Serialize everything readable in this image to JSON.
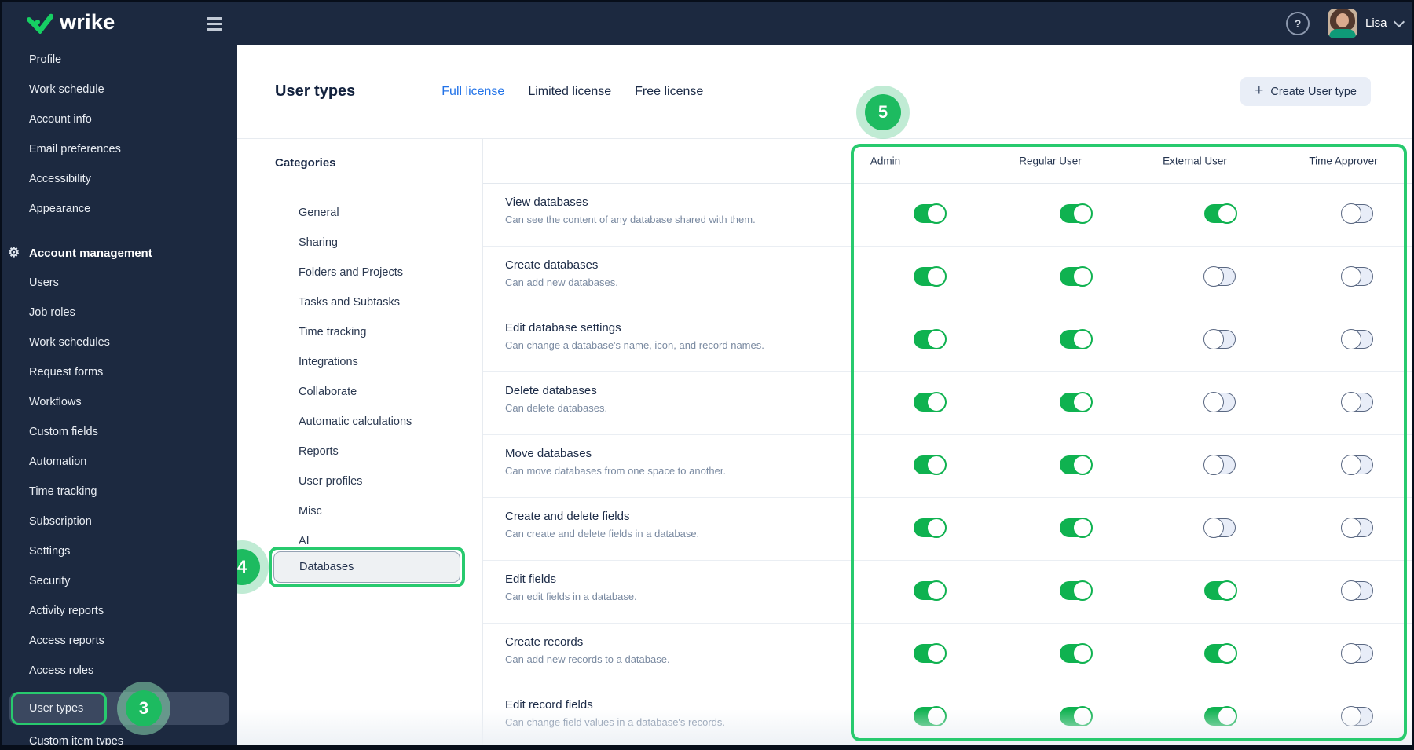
{
  "topbar": {
    "brand": "wrike",
    "help_label": "?",
    "user": {
      "name": "Lisa"
    }
  },
  "sidebar": {
    "items": [
      {
        "label": "Profile",
        "type": "item"
      },
      {
        "label": "Work schedule",
        "type": "item"
      },
      {
        "label": "Account info",
        "type": "item"
      },
      {
        "label": "Email preferences",
        "type": "item"
      },
      {
        "label": "Accessibility",
        "type": "item"
      },
      {
        "label": "Appearance",
        "type": "item"
      },
      {
        "label": "Account management",
        "type": "section",
        "icon": "gear-icon"
      },
      {
        "label": "Users",
        "type": "item"
      },
      {
        "label": "Job roles",
        "type": "item"
      },
      {
        "label": "Work schedules",
        "type": "item"
      },
      {
        "label": "Request forms",
        "type": "item"
      },
      {
        "label": "Workflows",
        "type": "item"
      },
      {
        "label": "Custom fields",
        "type": "item"
      },
      {
        "label": "Automation",
        "type": "item"
      },
      {
        "label": "Time tracking",
        "type": "item"
      },
      {
        "label": "Subscription",
        "type": "item"
      },
      {
        "label": "Settings",
        "type": "item"
      },
      {
        "label": "Security",
        "type": "item"
      },
      {
        "label": "Activity reports",
        "type": "item"
      },
      {
        "label": "Access reports",
        "type": "item"
      },
      {
        "label": "Access roles",
        "type": "item"
      },
      {
        "label": "User types",
        "type": "selected"
      },
      {
        "label": "Custom item types",
        "type": "item"
      }
    ]
  },
  "header": {
    "title": "User types",
    "tabs": [
      {
        "label": "Full license",
        "active": true
      },
      {
        "label": "Limited license",
        "active": false
      },
      {
        "label": "Free license",
        "active": false
      }
    ],
    "create_button": {
      "plus": "+",
      "label": "Create User type"
    }
  },
  "categories": {
    "title": "Categories",
    "items": [
      "General",
      "Sharing",
      "Folders and Projects",
      "Tasks and Subtasks",
      "Time tracking",
      "Integrations",
      "Collaborate",
      "Automatic calculations",
      "Reports",
      "User profiles",
      "Misc",
      "AI",
      "Databases"
    ],
    "selected": "Databases"
  },
  "permissions": {
    "columns": [
      "Admin",
      "Regular User",
      "External User",
      "Time Approver"
    ],
    "rows": [
      {
        "title": "View databases",
        "description": "Can see the content of any database shared with them.",
        "toggles": [
          true,
          true,
          true,
          false
        ]
      },
      {
        "title": "Create databases",
        "description": "Can add new databases.",
        "toggles": [
          true,
          true,
          false,
          false
        ]
      },
      {
        "title": "Edit database settings",
        "description": "Can change a database's name, icon, and record names.",
        "toggles": [
          true,
          true,
          false,
          false
        ]
      },
      {
        "title": "Delete databases",
        "description": "Can delete databases.",
        "toggles": [
          true,
          true,
          false,
          false
        ]
      },
      {
        "title": "Move databases",
        "description": "Can move databases from one space to another.",
        "toggles": [
          true,
          true,
          false,
          false
        ]
      },
      {
        "title": "Create and delete fields",
        "description": "Can create and delete fields in a database.",
        "toggles": [
          true,
          true,
          false,
          false
        ]
      },
      {
        "title": "Edit fields",
        "description": "Can edit fields in a database.",
        "toggles": [
          true,
          true,
          true,
          false
        ]
      },
      {
        "title": "Create records",
        "description": "Can add new records to a database.",
        "toggles": [
          true,
          true,
          true,
          false
        ]
      },
      {
        "title": "Edit record fields",
        "description": "Can change field values in a database's records.",
        "toggles": [
          true,
          true,
          true,
          false
        ]
      }
    ]
  },
  "annotations": {
    "step3": "3",
    "step4": "4",
    "step5": "5"
  },
  "colors": {
    "annotation_green": "#28ca6e",
    "badge_green": "#1dbb60",
    "toggle_on_green": "#0fb250",
    "active_tab_blue": "#2273e8",
    "dark_navy": "#1c2940"
  }
}
